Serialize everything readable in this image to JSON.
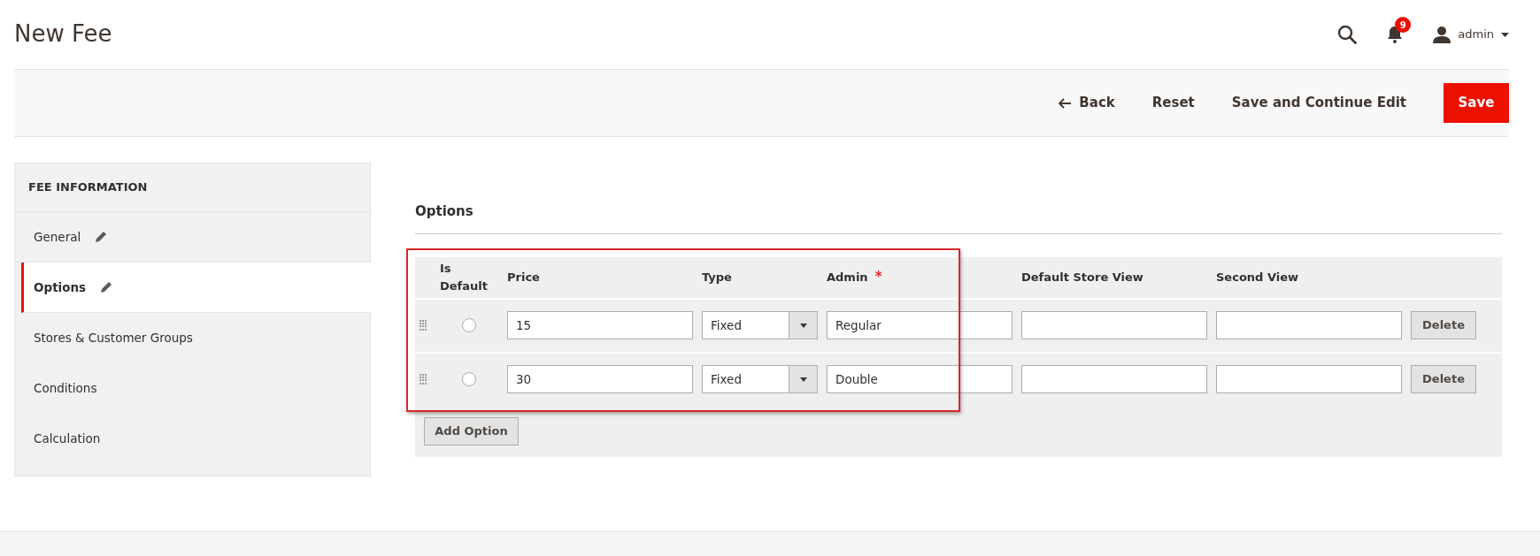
{
  "header": {
    "title": "New Fee",
    "notifications": "9",
    "user": "admin"
  },
  "actions": [
    {
      "label": "Back",
      "kind": "back"
    },
    {
      "label": "Reset",
      "kind": "link"
    },
    {
      "label": "Save and Continue Edit",
      "kind": "link"
    },
    {
      "label": "Save",
      "kind": "primary"
    }
  ],
  "sidebar": {
    "title": "FEE INFORMATION",
    "items": [
      {
        "label": "General",
        "selected": false,
        "edited": true
      },
      {
        "label": "Options",
        "selected": true,
        "edited": true
      },
      {
        "label": "Stores & Customer Groups",
        "selected": false,
        "edited": false
      },
      {
        "label": "Conditions",
        "selected": false,
        "edited": false
      },
      {
        "label": "Calculation",
        "selected": false,
        "edited": false
      }
    ]
  },
  "options": {
    "title": "Options",
    "columns": [
      {
        "label": "Is Default"
      },
      {
        "label": "Price"
      },
      {
        "label": "Type"
      },
      {
        "label": "Admin",
        "required_mark": "*"
      },
      {
        "label": "Default Store View"
      },
      {
        "label": "Second View"
      }
    ],
    "rows": [
      {
        "is_default": false,
        "price": "15",
        "type": "Fixed",
        "admin": "Regular",
        "delete": "Delete"
      },
      {
        "is_default": false,
        "price": "30",
        "type": "Fixed",
        "admin": "Double",
        "delete": "Delete"
      }
    ],
    "add_button": "Add Option"
  }
}
